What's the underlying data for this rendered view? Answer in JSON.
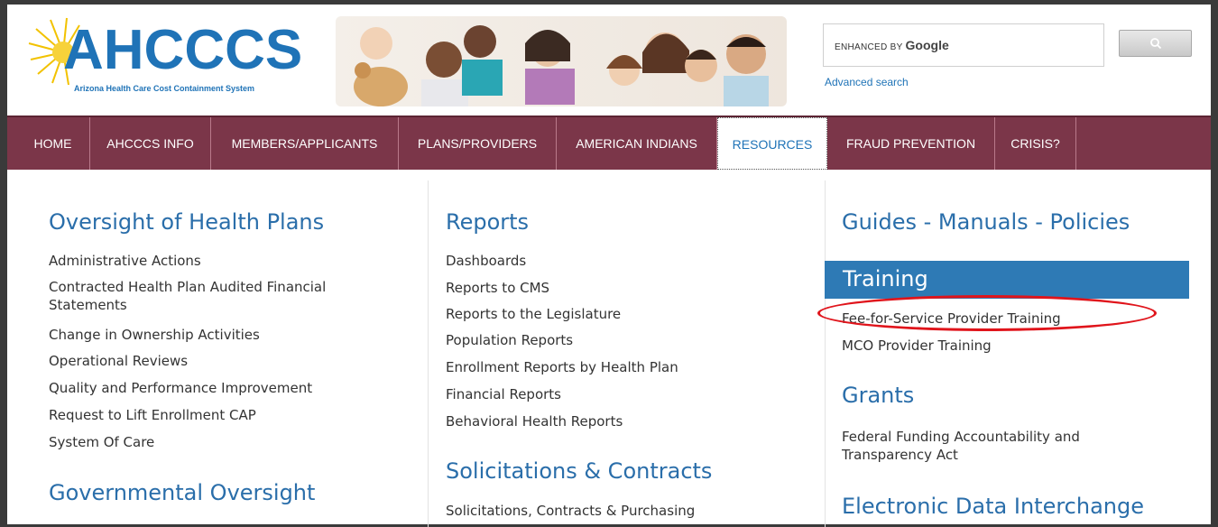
{
  "header": {
    "logo_text": "AHCCCS",
    "logo_subtitle": "Arizona Health Care Cost Containment System",
    "search": {
      "enhanced_by": "ENHANCED BY",
      "google": "Google",
      "button_icon": "search-icon"
    },
    "advanced_search": "Advanced search"
  },
  "nav": {
    "items": [
      {
        "label": "HOME"
      },
      {
        "label": "AHCCCS INFO"
      },
      {
        "label": "MEMBERS/APPLICANTS"
      },
      {
        "label": "PLANS/PROVIDERS"
      },
      {
        "label": "AMERICAN INDIANS"
      },
      {
        "label": "RESOURCES",
        "active": true
      },
      {
        "label": "FRAUD PREVENTION"
      },
      {
        "label": "CRISIS?"
      }
    ]
  },
  "col1": {
    "heading1": "Oversight of Health Plans",
    "links": [
      "Administrative Actions",
      "Contracted Health Plan Audited Financial Statements",
      "Change in Ownership Activities",
      "Operational Reviews",
      "Quality and Performance Improvement",
      "Request to Lift Enrollment CAP",
      "System Of Care"
    ],
    "heading2": "Governmental Oversight"
  },
  "col2": {
    "heading1": "Reports",
    "links": [
      "Dashboards",
      "Reports to CMS",
      "Reports to the Legislature",
      "Population Reports",
      "Enrollment Reports by Health Plan",
      "Financial Reports",
      "Behavioral Health Reports"
    ],
    "heading2": "Solicitations & Contracts",
    "links2": [
      "Solicitations, Contracts & Purchasing"
    ]
  },
  "col3": {
    "heading1": "Guides - Manuals - Policies",
    "training": "Training",
    "training_links": [
      "Fee-for-Service Provider Training",
      "MCO Provider Training"
    ],
    "heading2": "Grants",
    "grants_links": [
      "Federal Funding Accountability and Transparency Act"
    ],
    "heading3": "Electronic Data Interchange"
  },
  "colors": {
    "nav_bg": "#7b3649",
    "link_blue": "#2a6eaa",
    "training_bar": "#2e7ab5",
    "annotation_red": "#e0141b"
  }
}
